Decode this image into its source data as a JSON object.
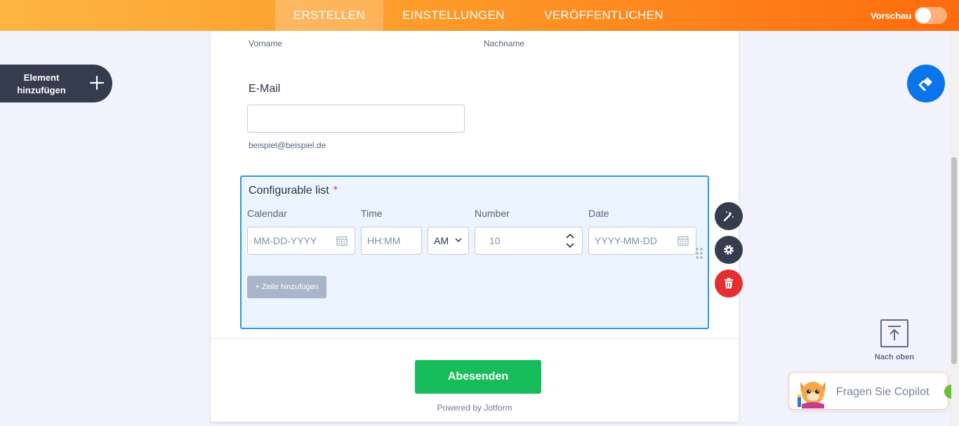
{
  "header": {
    "tabs": [
      {
        "label": "ERSTELLEN",
        "active": true
      },
      {
        "label": "EINSTELLUNGEN",
        "active": false
      },
      {
        "label": "VERÖFFENTLICHEN",
        "active": false
      }
    ],
    "preview_label": "Vorschau",
    "preview_on": false
  },
  "sidebar": {
    "add_element_label": "Element hinzufügen"
  },
  "form": {
    "name_sublabels": {
      "first": "Vorname",
      "last": "Nachname"
    },
    "email": {
      "label": "E-Mail",
      "value": "",
      "sublabel": "beispiel@beispiel.de"
    },
    "configurable_list": {
      "title": "Configurable list",
      "required_mark": "*",
      "columns": [
        "Calendar",
        "Time",
        "Number",
        "Date"
      ],
      "fields": {
        "calendar_placeholder": "MM-DD-YYYY",
        "time_placeholder": "HH:MM",
        "ampm_value": "AM",
        "number_placeholder": "10",
        "date_placeholder": "YYYY-MM-DD"
      },
      "add_row_label": "+ Zeile hinzufügen"
    },
    "submit_label": "Abesenden",
    "powered_by": "Powered by Jotform"
  },
  "right_panel": {
    "back_to_top_label": "Nach oben",
    "copilot_label": "Fragen Sie Copilot"
  },
  "colors": {
    "accent_blue": "#2a97e9",
    "submit_green": "#18bd5b",
    "delete_red": "#e42f2f",
    "dark_button": "#343c4e"
  }
}
